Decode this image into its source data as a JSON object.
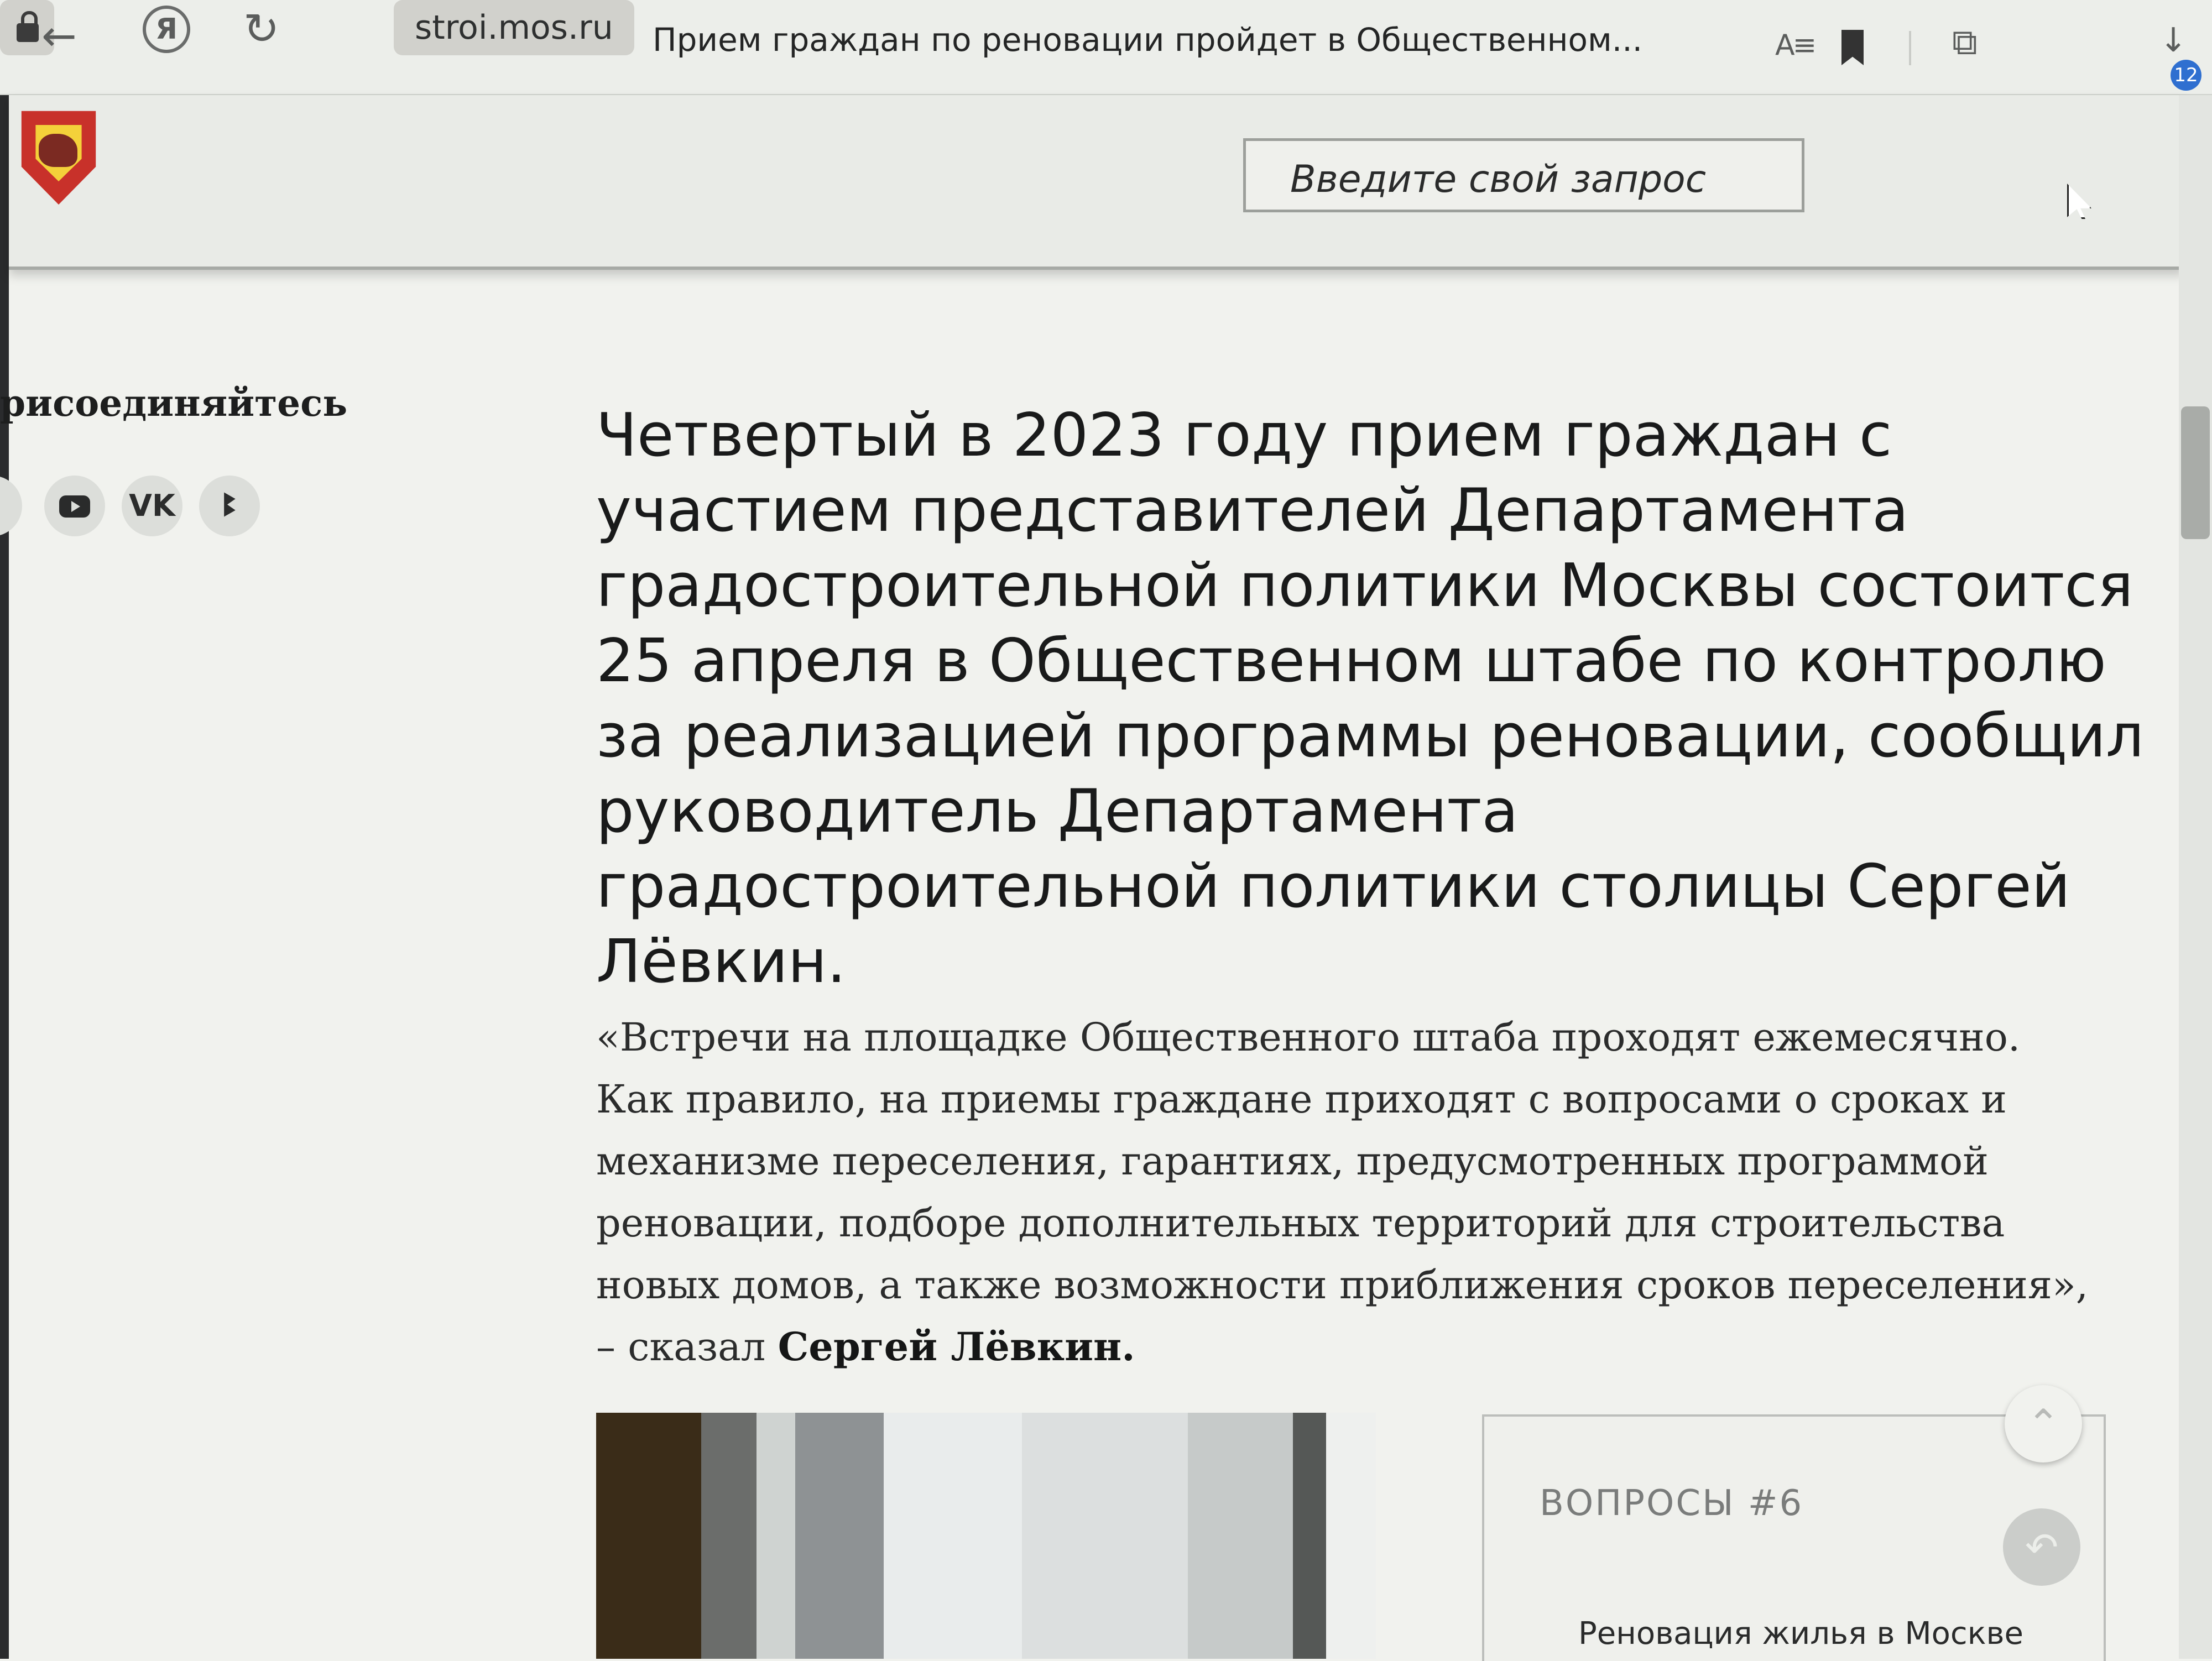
{
  "browser": {
    "back_glyph": "←",
    "yandex_glyph": "Я",
    "reload_glyph": "↻",
    "url": "stroi.mos.ru",
    "tab_title": "Прием граждан по реновации пройдет в Общественном...",
    "reader_glyph": "A≡",
    "download_glyph": "↓",
    "download_count": "12",
    "ext_glyph": "⧉"
  },
  "header": {
    "search_placeholder": "Введите свой запрос"
  },
  "sidebar": {
    "heading": "рисоединяйтесь",
    "vk_label": "VK",
    "ok_glyph": "ꔪ"
  },
  "article": {
    "headline": "Четвертый в 2023 году прием граждан с участием представителей Департамента градостроительной политики Москвы состоится 25 апреля в Общественном штабе по контролю за реализацией программы реновации, сообщил руководитель Департамента градостроительной политики столицы Сергей Лёвкин.",
    "quote_text": "«Встречи на площадке Общественного штаба проходят ежемесячно. Как правило, на приемы граждане приходят с вопросами о сроках и механизме переселения, гарантиях, предусмотренных программой реновации, подборе дополнительных территорий для строительства новых домов, а также возможности приближения сроков переселения», – сказал",
    "quote_author": "Сергей Лёвкин."
  },
  "widget": {
    "title": "ВОПРОСЫ   #6",
    "subtitle": "Реновация жилья в Москве"
  },
  "controls": {
    "scroll_up_glyph": "⌃",
    "back_glyph": "↶"
  }
}
